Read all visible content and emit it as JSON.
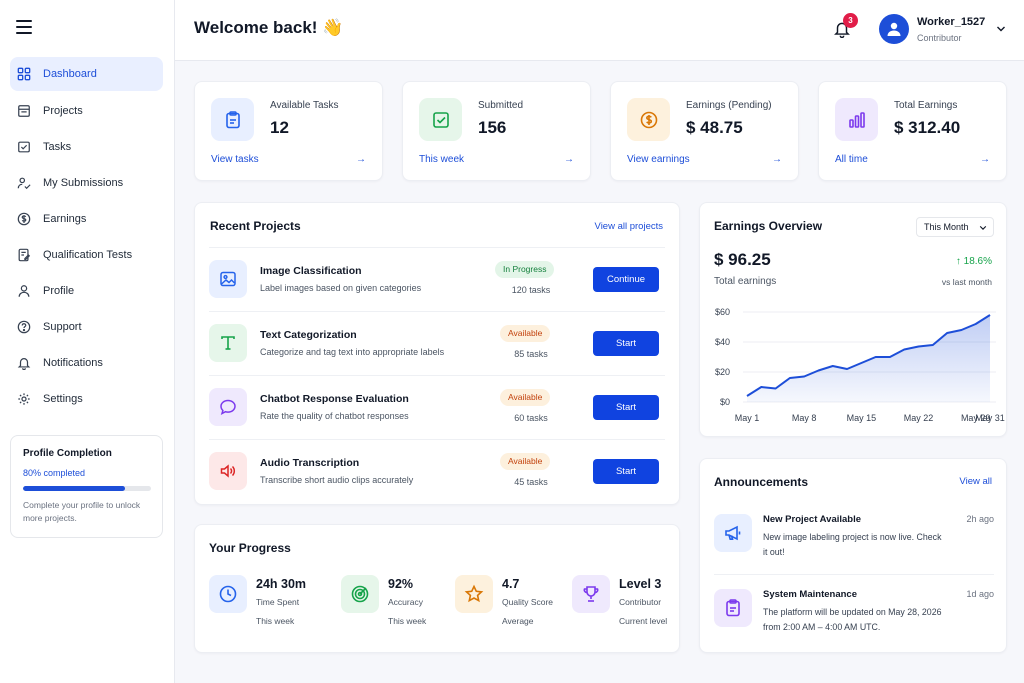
{
  "sidebar": {
    "items": [
      {
        "label": "Dashboard",
        "icon": "dashboard-icon",
        "active": true
      },
      {
        "label": "Projects",
        "icon": "projects-icon"
      },
      {
        "label": "Tasks",
        "icon": "tasks-icon"
      },
      {
        "label": "My Submissions",
        "icon": "submissions-icon"
      },
      {
        "label": "Earnings",
        "icon": "dollar-icon"
      },
      {
        "label": "Qualification Tests",
        "icon": "test-icon"
      },
      {
        "label": "Profile",
        "icon": "user-icon"
      },
      {
        "label": "Support",
        "icon": "help-icon"
      },
      {
        "label": "Notifications",
        "icon": "bell-icon"
      },
      {
        "label": "Settings",
        "icon": "gear-icon"
      }
    ],
    "profile_completion": {
      "title": "Profile Completion",
      "status": "80% completed",
      "percent": 80,
      "description": "Complete your profile to unlock more projects."
    }
  },
  "header": {
    "welcome": "Welcome back! 👋",
    "notification_count": "3",
    "user_name": "Worker_1527",
    "user_role": "Contributor"
  },
  "stats": [
    {
      "label": "Available Tasks",
      "value": "12",
      "link": "View tasks",
      "icon": "clipboard-icon",
      "color": "#2563eb",
      "bg": "#e8efff"
    },
    {
      "label": "Submitted",
      "value": "156",
      "link": "This week",
      "icon": "checkbox-icon",
      "color": "#16a34a",
      "bg": "#e6f6ea"
    },
    {
      "label": "Earnings (Pending)",
      "value": "$ 48.75",
      "link": "View earnings",
      "icon": "coin-icon",
      "color": "#d97706",
      "bg": "#fdf1dd"
    },
    {
      "label": "Total Earnings",
      "value": "$ 312.40",
      "link": "All time",
      "icon": "bar-chart-icon",
      "color": "#7c3aed",
      "bg": "#efe9fd"
    }
  ],
  "recent_projects": {
    "title": "Recent Projects",
    "view_all": "View all projects",
    "items": [
      {
        "name": "Image Classification",
        "desc": "Label images based on given categories",
        "status": "In Progress",
        "status_color": "#15803d",
        "status_bg": "#e3f5e8",
        "count": "120 tasks",
        "action": "Continue",
        "icon": "image-icon",
        "icon_color": "#2563eb",
        "icon_bg": "#e8efff"
      },
      {
        "name": "Text Categorization",
        "desc": "Categorize and tag text into appropriate labels",
        "status": "Available",
        "status_color": "#c2410c",
        "status_bg": "#fdf0dd",
        "count": "85 tasks",
        "action": "Start",
        "icon": "text-icon",
        "icon_color": "#16a34a",
        "icon_bg": "#e6f6ea"
      },
      {
        "name": "Chatbot Response Evaluation",
        "desc": "Rate the quality of chatbot responses",
        "status": "Available",
        "status_color": "#c2410c",
        "status_bg": "#fdf0dd",
        "count": "60 tasks",
        "action": "Start",
        "icon": "chat-icon",
        "icon_color": "#7c3aed",
        "icon_bg": "#efe9fd"
      },
      {
        "name": "Audio Transcription",
        "desc": "Transcribe short audio clips accurately",
        "status": "Available",
        "status_color": "#c2410c",
        "status_bg": "#fdf0dd",
        "count": "45 tasks",
        "action": "Start",
        "icon": "speaker-icon",
        "icon_color": "#dc2626",
        "icon_bg": "#fde8e8"
      }
    ]
  },
  "progress": {
    "title": "Your Progress",
    "items": [
      {
        "value": "24h 30m",
        "label": "Time Spent",
        "sub": "This week",
        "icon": "clock-icon",
        "color": "#2563eb",
        "bg": "#e8efff"
      },
      {
        "value": "92%",
        "label": "Accuracy",
        "sub": "This week",
        "icon": "target-icon",
        "color": "#16a34a",
        "bg": "#e6f6ea"
      },
      {
        "value": "4.7",
        "label": "Quality Score",
        "sub": "Average",
        "icon": "star-icon",
        "color": "#d97706",
        "bg": "#fdf1dd"
      },
      {
        "value": "Level 3",
        "label": "Contributor",
        "sub": "Current level",
        "icon": "trophy-icon",
        "color": "#7c3aed",
        "bg": "#efe9fd"
      }
    ]
  },
  "earnings_overview": {
    "title": "Earnings Overview",
    "period": "This Month",
    "total": "$ 96.25",
    "total_label": "Total earnings",
    "change": "↑ 18.6%",
    "change_label": "vs last month"
  },
  "chart_data": {
    "type": "area",
    "x": [
      "May 1",
      "May 3",
      "May 5",
      "May 7",
      "May 8",
      "May 10",
      "May 12",
      "May 14",
      "May 15",
      "May 17",
      "May 19",
      "May 21",
      "May 22",
      "May 24",
      "May 26",
      "May 28",
      "May 29",
      "May 31"
    ],
    "y": [
      4,
      10,
      9,
      16,
      17,
      21,
      24,
      22,
      26,
      30,
      30,
      35,
      37,
      38,
      46,
      48,
      52,
      58
    ],
    "x_ticks": [
      "May 1",
      "May 8",
      "May 15",
      "May 22",
      "May 29",
      "May 31"
    ],
    "y_ticks": [
      "$0",
      "$20",
      "$40",
      "$60"
    ],
    "ylim": [
      0,
      60
    ],
    "color": "#1d4ed8"
  },
  "announcements": {
    "title": "Announcements",
    "view_all": "View all",
    "items": [
      {
        "title": "New Project Available",
        "body": "New image labeling project is now live. Check it out!",
        "time": "2h ago",
        "icon": "megaphone-icon",
        "color": "#2563eb",
        "bg": "#e8efff"
      },
      {
        "title": "System Maintenance",
        "body": "The platform will be updated on May 28, 2026 from 2:00 AM – 4:00 AM UTC.",
        "time": "1d ago",
        "icon": "clipboard-icon",
        "color": "#7c3aed",
        "bg": "#efe9fd"
      }
    ]
  }
}
